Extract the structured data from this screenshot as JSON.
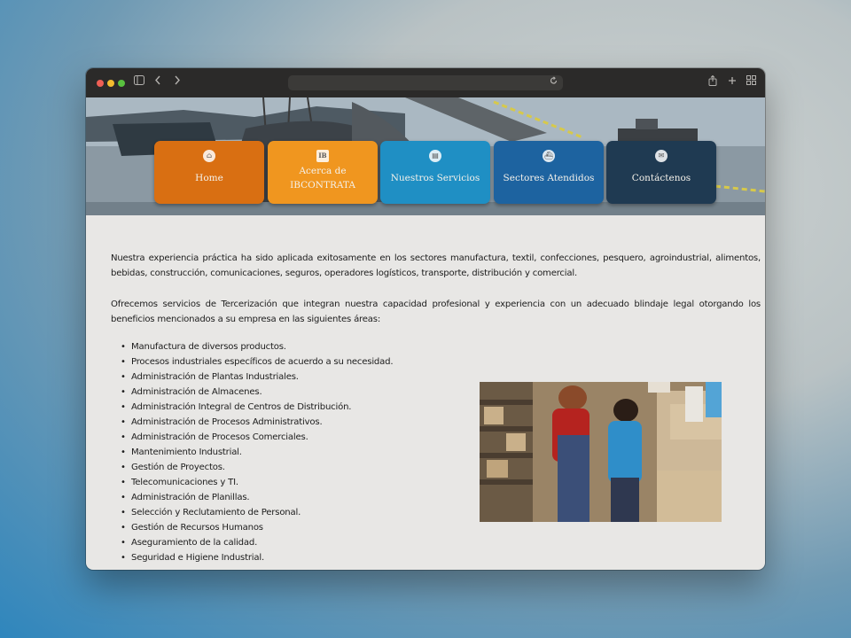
{
  "browser": {
    "icons": {
      "sidebar": "sidebar-icon",
      "back": "chevron-left-icon",
      "forward": "chevron-right-icon",
      "reload": "reload-icon",
      "share": "share-icon",
      "new_tab": "plus-icon",
      "tabs": "tab-overview-icon"
    },
    "address_value": ""
  },
  "nav": [
    {
      "label": "Home",
      "icon": "home-icon",
      "color": "#d96f12"
    },
    {
      "label": "Acerca de IBCONTRATA",
      "icon": "ib-icon",
      "color": "#f0961f"
    },
    {
      "label": "Nuestros Servicios",
      "icon": "document-icon",
      "color": "#1f8fc4"
    },
    {
      "label": "Sectores Atendidos",
      "icon": "ship-icon",
      "color": "#1d63a0"
    },
    {
      "label": "Contáctenos",
      "icon": "envelope-icon",
      "color": "#1f3a52"
    }
  ],
  "content": {
    "paragraph1": "Nuestra experiencia práctica ha sido aplicada exitosamente en los sectores manufactura, textil, confecciones, pesquero, agroindustrial, alimentos, bebidas, construcción, comunicaciones, seguros, operadores logísticos, transporte, distribución y comercial.",
    "paragraph2": "Ofrecemos servicios de Tercerización que integran nuestra capacidad profesional y experiencia con un adecuado blindaje legal otorgando los beneficios mencionados a su empresa en las siguientes áreas:",
    "areas": [
      "Manufactura de diversos productos.",
      "Procesos industriales específicos de acuerdo a su necesidad.",
      "Administración de Plantas Industriales.",
      "Administración de Almacenes.",
      "Administración Integral de Centros de Distribución.",
      "Administración de Procesos Administrativos.",
      "Administración de Procesos Comerciales.",
      "Mantenimiento Industrial.",
      "Gestión de Proyectos.",
      "Telecomunicaciones y TI.",
      "Administración de Planillas.",
      "Selección y Reclutamiento de Personal.",
      "Gestión de Recursos Humanos",
      "Aseguramiento de la calidad.",
      "Seguridad e Higiene Industrial."
    ]
  }
}
